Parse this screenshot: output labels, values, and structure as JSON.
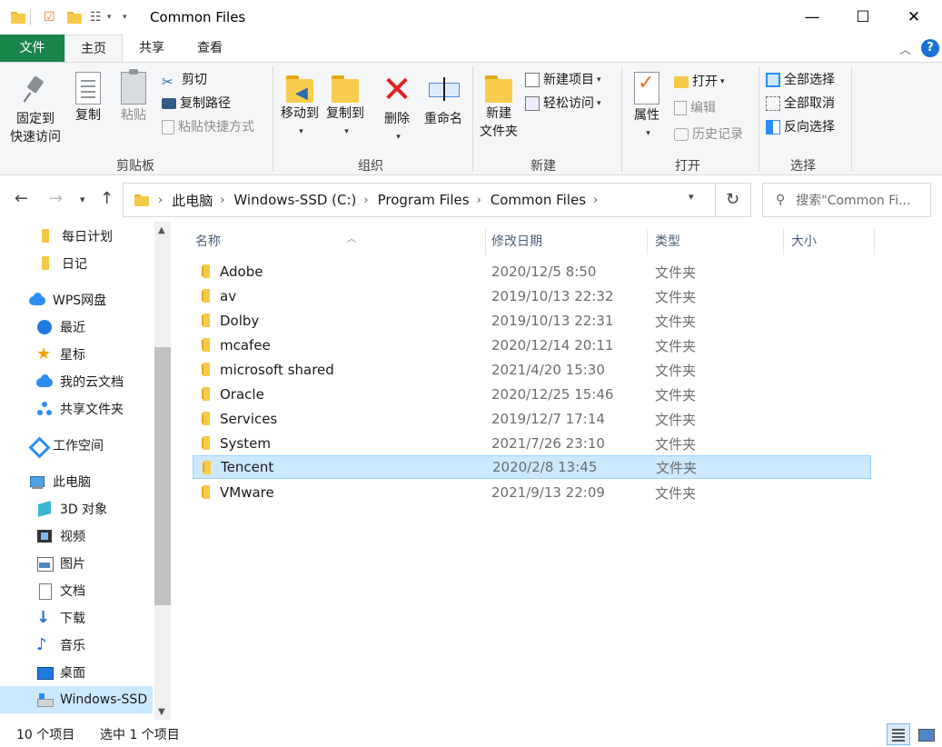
{
  "window": {
    "title": "Common Files",
    "minimize": "—",
    "maximize": "☐",
    "close": "✕"
  },
  "ribbon_tabs": {
    "file": "文件",
    "home": "主页",
    "share": "共享",
    "view": "查看",
    "help": "?",
    "collapse": "︿"
  },
  "ribbon": {
    "clipboard": {
      "label": "剪贴板",
      "pin_line1": "固定到",
      "pin_line2": "快速访问",
      "copy": "复制",
      "paste": "粘贴",
      "cut": "剪切",
      "copy_path": "复制路径",
      "paste_shortcut": "粘贴快捷方式"
    },
    "organize": {
      "label": "组织",
      "move_to": "移动到",
      "copy_to": "复制到",
      "delete": "删除",
      "rename": "重命名"
    },
    "new": {
      "label": "新建",
      "new_folder_line1": "新建",
      "new_folder_line2": "文件夹",
      "new_item": "新建项目",
      "easy_access": "轻松访问"
    },
    "open": {
      "label": "打开",
      "properties": "属性",
      "open": "打开",
      "edit": "编辑",
      "history": "历史记录"
    },
    "select": {
      "label": "选择",
      "select_all": "全部选择",
      "select_none": "全部取消",
      "invert": "反向选择"
    }
  },
  "address": {
    "crumbs": [
      "此电脑",
      "Windows-SSD (C:)",
      "Program Files",
      "Common Files"
    ],
    "search_placeholder": "搜索\"Common Fi..."
  },
  "nav": {
    "items": [
      {
        "label": "每日计划",
        "icon": "folder-icon"
      },
      {
        "label": "日记",
        "icon": "folder-icon"
      },
      {
        "label": "WPS网盘",
        "icon": "cloud-icon"
      },
      {
        "label": "最近",
        "icon": "clock-icon"
      },
      {
        "label": "星标",
        "icon": "star-icon"
      },
      {
        "label": "我的云文档",
        "icon": "cloud-icon"
      },
      {
        "label": "共享文件夹",
        "icon": "share-icon"
      },
      {
        "label": "工作空间",
        "icon": "workspace-icon"
      },
      {
        "label": "此电脑",
        "icon": "pc-icon"
      },
      {
        "label": "3D 对象",
        "icon": "3d-objects-icon"
      },
      {
        "label": "视频",
        "icon": "video-icon"
      },
      {
        "label": "图片",
        "icon": "pictures-icon"
      },
      {
        "label": "文档",
        "icon": "documents-icon"
      },
      {
        "label": "下载",
        "icon": "download-icon"
      },
      {
        "label": "音乐",
        "icon": "music-icon"
      },
      {
        "label": "桌面",
        "icon": "desktop-icon"
      },
      {
        "label": "Windows-SSD",
        "icon": "drive-icon"
      }
    ]
  },
  "columns": {
    "name": "名称",
    "modified": "修改日期",
    "type": "类型",
    "size": "大小"
  },
  "files": [
    {
      "name": "Adobe",
      "modified": "2020/12/5 8:50",
      "type": "文件夹"
    },
    {
      "name": "av",
      "modified": "2019/10/13 22:32",
      "type": "文件夹"
    },
    {
      "name": "Dolby",
      "modified": "2019/10/13 22:31",
      "type": "文件夹"
    },
    {
      "name": "mcafee",
      "modified": "2020/12/14 20:11",
      "type": "文件夹"
    },
    {
      "name": "microsoft shared",
      "modified": "2021/4/20 15:30",
      "type": "文件夹"
    },
    {
      "name": "Oracle",
      "modified": "2020/12/25 15:46",
      "type": "文件夹"
    },
    {
      "name": "Services",
      "modified": "2019/12/7 17:14",
      "type": "文件夹"
    },
    {
      "name": "System",
      "modified": "2021/7/26 23:10",
      "type": "文件夹"
    },
    {
      "name": "Tencent",
      "modified": "2020/2/8 13:45",
      "type": "文件夹"
    },
    {
      "name": "VMware",
      "modified": "2021/9/13 22:09",
      "type": "文件夹"
    }
  ],
  "status": {
    "count": "10 个项目",
    "selected": "选中 1 个项目"
  },
  "colors": {
    "file_tab": "#19854a",
    "selection": "#cce8ff",
    "folder": "#f7c948"
  }
}
